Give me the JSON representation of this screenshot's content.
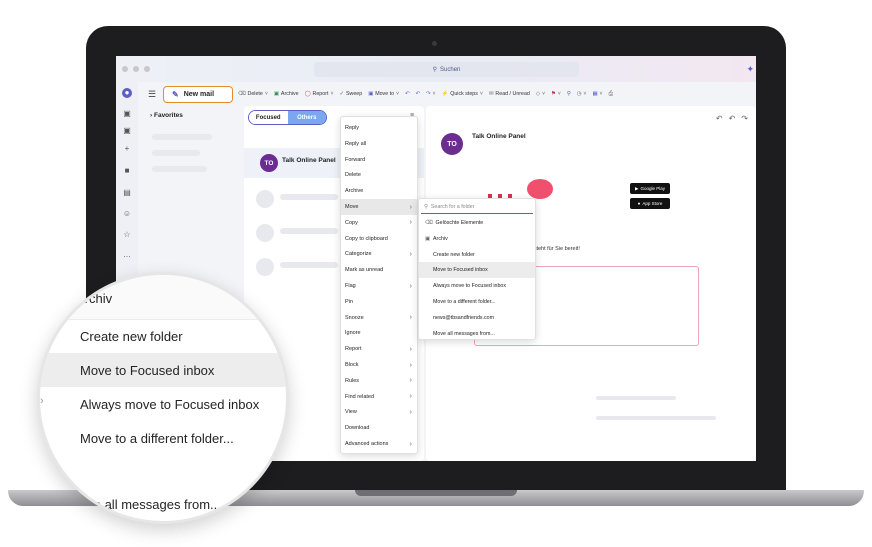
{
  "titlebar": {
    "search_label": "Suchen"
  },
  "nav": {
    "new_mail": "New mail",
    "favorites": "Favorites"
  },
  "ribbon": {
    "items": [
      "Delete",
      "Archive",
      "Report",
      "Sweep",
      "Move to",
      "Quick steps",
      "Read / Unread"
    ]
  },
  "list": {
    "tabs": [
      "Focused",
      "Others"
    ],
    "message": {
      "avatar": "TO",
      "sender": "Talk Online Panel"
    }
  },
  "context_menu": {
    "items": [
      {
        "label": "Reply",
        "submenu": false
      },
      {
        "label": "Reply all",
        "submenu": false
      },
      {
        "label": "Forward",
        "submenu": false
      },
      {
        "label": "Delete",
        "submenu": false
      },
      {
        "label": "Archive",
        "submenu": false
      },
      {
        "label": "Move",
        "submenu": true
      },
      {
        "label": "Copy",
        "submenu": true
      },
      {
        "label": "Copy to clipboard",
        "submenu": false
      },
      {
        "label": "Categorize",
        "submenu": true
      },
      {
        "label": "Mark as unread",
        "submenu": false
      },
      {
        "label": "Flag",
        "submenu": true
      },
      {
        "label": "Pin",
        "submenu": false
      },
      {
        "label": "Snooze",
        "submenu": true
      },
      {
        "label": "Ignore",
        "submenu": false
      },
      {
        "label": "Report",
        "submenu": true
      },
      {
        "label": "Block",
        "submenu": true
      },
      {
        "label": "Rules",
        "submenu": true
      },
      {
        "label": "Find related",
        "submenu": true
      },
      {
        "label": "View",
        "submenu": true
      },
      {
        "label": "Download",
        "submenu": false
      },
      {
        "label": "Advanced actions",
        "submenu": true
      }
    ],
    "highlighted": "Move"
  },
  "move_submenu": {
    "search_placeholder": "Search for a folder",
    "items": [
      "Gelöschte Elemente",
      "Archiv",
      "Create new folder",
      "Move to Focused inbox",
      "Always move to Focused inbox",
      "Move to a different folder...",
      "news@tbsandfriends.com",
      "Move all messages from..."
    ],
    "highlighted": "Move to Focused inbox"
  },
  "reading": {
    "avatar": "TO",
    "sender": "Talk Online Panel",
    "body_fragment": "age steht für Sie bereit!",
    "google_play": "Google Play",
    "app_store": "App Store"
  },
  "magnifier": {
    "items": [
      "Archiv",
      "Create new folder",
      "Move to Focused inbox",
      "Always move to Focused inbox",
      "Move to a different folder...",
      "ove all messages from..."
    ],
    "highlighted": "Move to Focused inbox"
  },
  "colors": {
    "accent": "#5b5fc7",
    "avatar": "#6b2d8f",
    "new_mail_border": "#e58c2e",
    "brand_red": "#f0506e"
  }
}
